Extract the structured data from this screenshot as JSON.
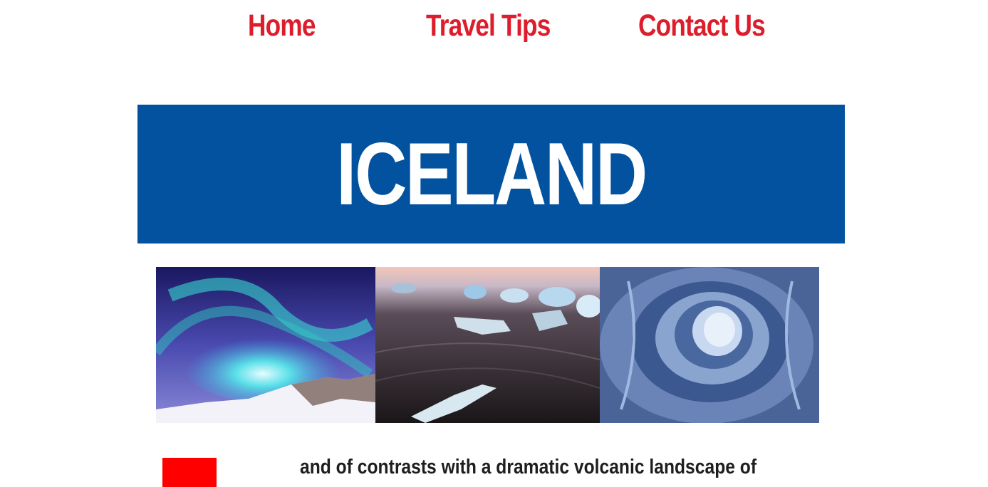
{
  "nav": {
    "home": "Home",
    "travel_tips": "Travel Tips",
    "contact_us": "Contact Us"
  },
  "hero": {
    "title": "ICELAND"
  },
  "gallery": [
    {
      "subject": "northern lights over snowy mountain"
    },
    {
      "subject": "ice chunks on black sand beach"
    },
    {
      "subject": "blue ice cave"
    }
  ],
  "intro": {
    "text": "and of contrasts with a dramatic volcanic landscape of"
  },
  "colors": {
    "nav_text": "#dd1c2c",
    "hero_background": "#02529f",
    "hero_text": "#ffffff",
    "accent_block": "#ff0000",
    "body_text": "#1e1e1e"
  }
}
